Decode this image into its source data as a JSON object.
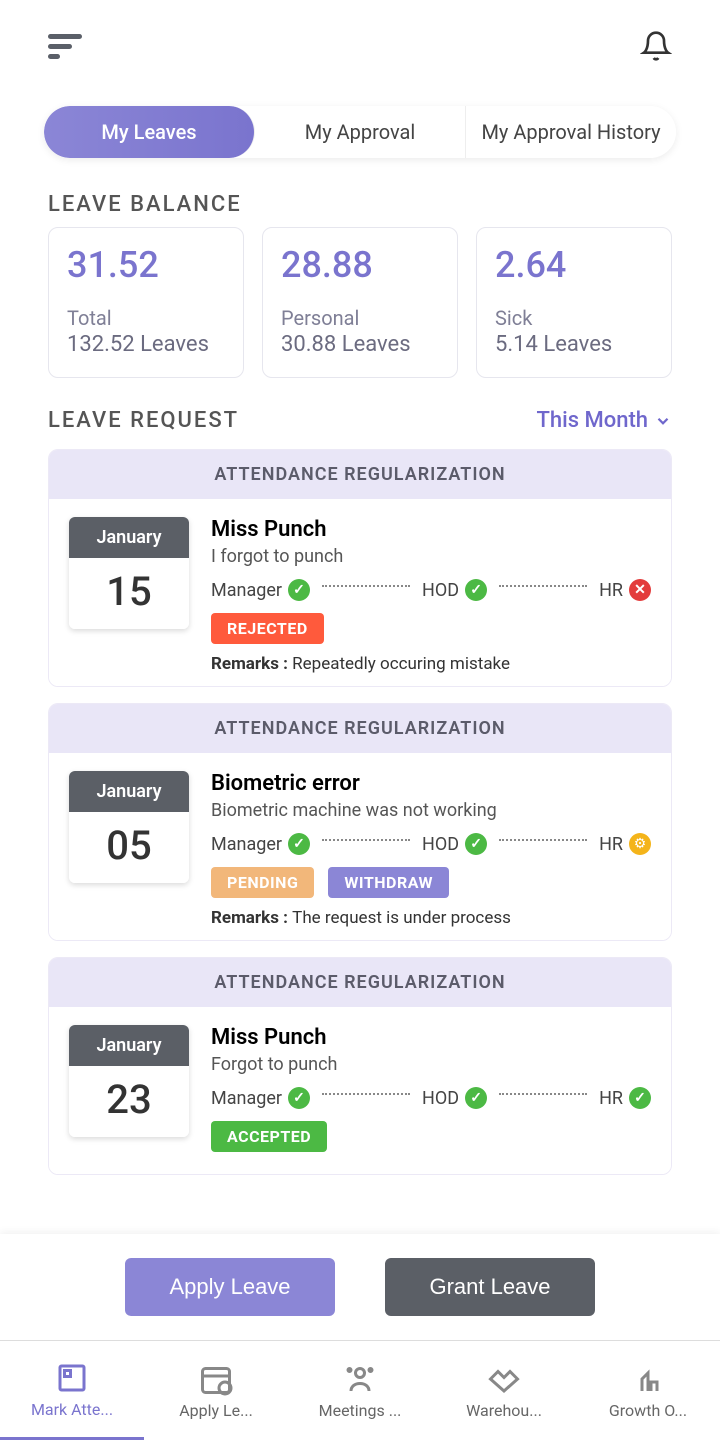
{
  "tabs": {
    "t0": "My Leaves",
    "t1": "My Approval",
    "t2": "My Approval History"
  },
  "sections": {
    "balance": "LEAVE  BALANCE",
    "request": "LEAVE  REQUEST"
  },
  "filter": "This Month",
  "balances": [
    {
      "value": "31.52",
      "label": "Total",
      "sub": "132.52 Leaves"
    },
    {
      "value": "28.88",
      "label": "Personal",
      "sub": "30.88 Leaves"
    },
    {
      "value": "2.64",
      "label": "Sick",
      "sub": "5.14 Leaves"
    }
  ],
  "cards": [
    {
      "head": "ATTENDANCE REGULARIZATION",
      "month": "January",
      "day": "15",
      "title": "Miss Punch",
      "sub": "I forgot to punch",
      "chain": {
        "l0": "Manager",
        "l1": "HOD",
        "l2": "HR"
      },
      "badges": [
        "REJECTED"
      ],
      "remarksL": "Remarks :",
      "remarksV": "Repeatedly occuring mistake"
    },
    {
      "head": "ATTENDANCE REGULARIZATION",
      "month": "January",
      "day": "05",
      "title": "Biometric error",
      "sub": "Biometric machine was not working",
      "chain": {
        "l0": "Manager",
        "l1": "HOD",
        "l2": "HR"
      },
      "badges": [
        "PENDING",
        "WITHDRAW"
      ],
      "remarksL": "Remarks :",
      "remarksV": "The request is under process"
    },
    {
      "head": "ATTENDANCE REGULARIZATION",
      "month": "January",
      "day": "23",
      "title": "Miss Punch",
      "sub": "Forgot to punch",
      "chain": {
        "l0": "Manager",
        "l1": "HOD",
        "l2": "HR"
      },
      "badges": [
        "ACCEPTED"
      ]
    }
  ],
  "actions": {
    "apply": "Apply Leave",
    "grant": "Grant Leave"
  },
  "nav": {
    "n0": "Mark Atte...",
    "n1": "Apply Le...",
    "n2": "Meetings ...",
    "n3": "Warehou...",
    "n4": "Growth O..."
  }
}
